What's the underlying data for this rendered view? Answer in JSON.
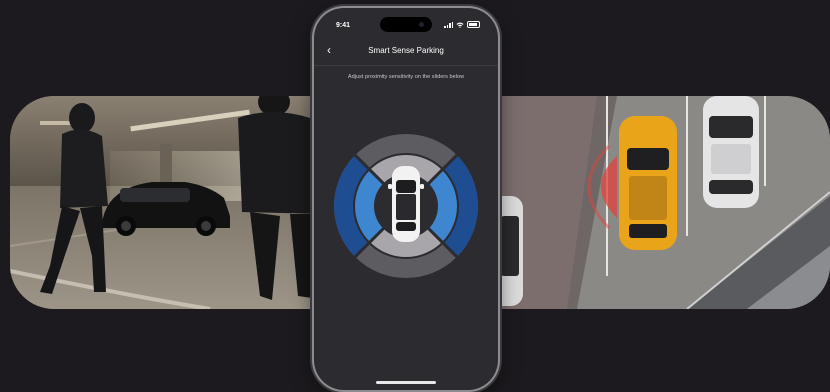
{
  "screen": {
    "title": "Smart Sense Parking",
    "subtitle": "Adjust proximity sensitivity on the sliders below"
  },
  "status_bar": {
    "time": "9:41",
    "icons": [
      "signal-icon",
      "wifi-icon",
      "battery-icon"
    ]
  },
  "header": {
    "back_icon": "chevron-left-icon",
    "back_glyph": "‹"
  },
  "sensor_dial": {
    "zones": [
      "front",
      "rear",
      "left",
      "right"
    ],
    "colors": {
      "outer_ring": "#5d5c61",
      "inner_ring": "#a8a6ab",
      "left_right_outer": "#1f4d91",
      "left_right_inner": "#3f86d0",
      "car_body": "#f2f2f2"
    }
  },
  "colors": {
    "background": "#1c1a1e",
    "phone_body": "#2c2b2f"
  }
}
